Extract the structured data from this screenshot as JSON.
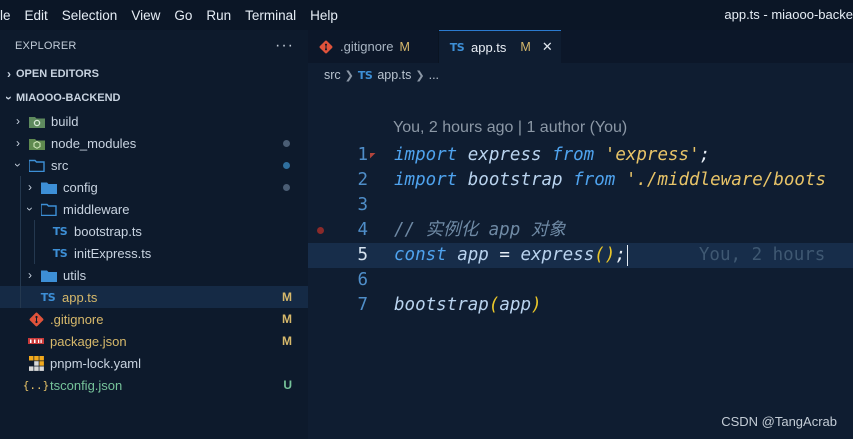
{
  "menubar": {
    "items": [
      "le",
      "Edit",
      "Selection",
      "View",
      "Go",
      "Run",
      "Terminal",
      "Help"
    ],
    "window_title": "app.ts - miaooo-backe"
  },
  "sidebar": {
    "title": "EXPLORER",
    "more_icon": "more-actions-icon",
    "open_editors": "OPEN EDITORS",
    "project": "MIAOOO-BACKEND",
    "tree": {
      "build": "build",
      "node_modules": "node_modules",
      "src": "src",
      "config": "config",
      "middleware": "middleware",
      "bootstrap": "bootstrap.ts",
      "initExpress": "initExpress.ts",
      "utils": "utils",
      "app": "app.ts",
      "app_status": "M",
      "gitignore": ".gitignore",
      "gitignore_status": "M",
      "package": "package.json",
      "package_status": "M",
      "pnpm": "pnpm-lock.yaml",
      "tsconfig": "tsconfig.json",
      "tsconfig_status": "U"
    },
    "colors": {
      "modified": "#d7b96b",
      "untracked": "#76c39a",
      "ts_icon": "#3d8fd6",
      "folder": "#3d8fd6"
    }
  },
  "tabs": [
    {
      "label": ".gitignore",
      "status": "M",
      "icon": "git-icon"
    },
    {
      "label": "app.ts",
      "status": "M",
      "icon": "typescript-icon",
      "close": "✕"
    }
  ],
  "breadcrumb": {
    "folder": "src",
    "file": "app.ts",
    "tail": "..."
  },
  "editor": {
    "codelens": "You, 2 hours ago | 1 author (You)",
    "line_numbers": [
      "1",
      "2",
      "3",
      "4",
      "5",
      "6",
      "7"
    ],
    "current_line": 5,
    "line1": {
      "kw": "import",
      "id": "express",
      "from": "from",
      "str": "'express'",
      "end": ";"
    },
    "line2": {
      "kw": "import",
      "id": "bootstrap",
      "from": "from",
      "str": "'./middleware/boots"
    },
    "line4": {
      "comment": "// 实例化 app 对象"
    },
    "line5": {
      "kw": "const",
      "id": "app",
      "eq": "=",
      "fn": "express",
      "open": "(",
      "close": ")",
      "end": ";",
      "blame": "You, 2 hours"
    },
    "line7": {
      "fn": "bootstrap",
      "open": "(",
      "arg": "app",
      "close": ")"
    }
  },
  "watermark": "CSDN @TangAcrab"
}
